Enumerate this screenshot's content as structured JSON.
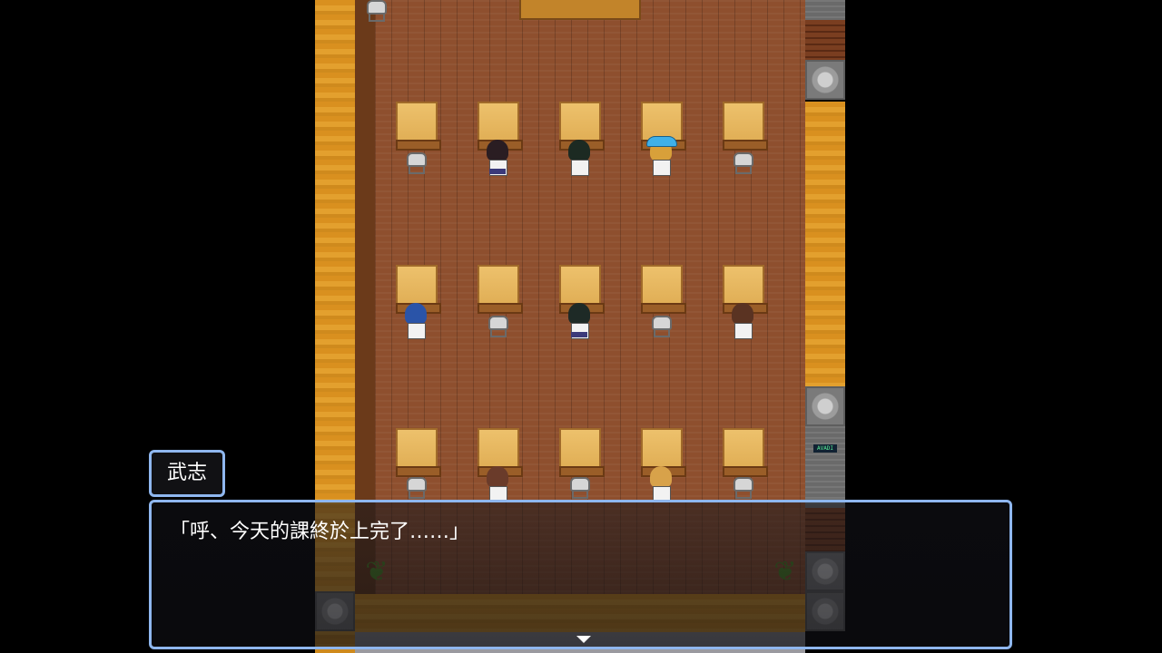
{
  "dialog": {
    "speaker": "武志",
    "message": "「呼、今天的課終於上完了……」"
  },
  "map": {
    "sign_text": "AVADI",
    "student_hair_colors": [
      "#2a1d22",
      "#1c2a22",
      "#d8a03a",
      "#2a54a8",
      "#1e2a26",
      "#5a3322",
      "#6a3b2a",
      "#d8a24a"
    ]
  },
  "colors": {
    "dialog_border": "#8fb7ef",
    "wall": "#d9901f",
    "floor": "#8e4f2e"
  }
}
